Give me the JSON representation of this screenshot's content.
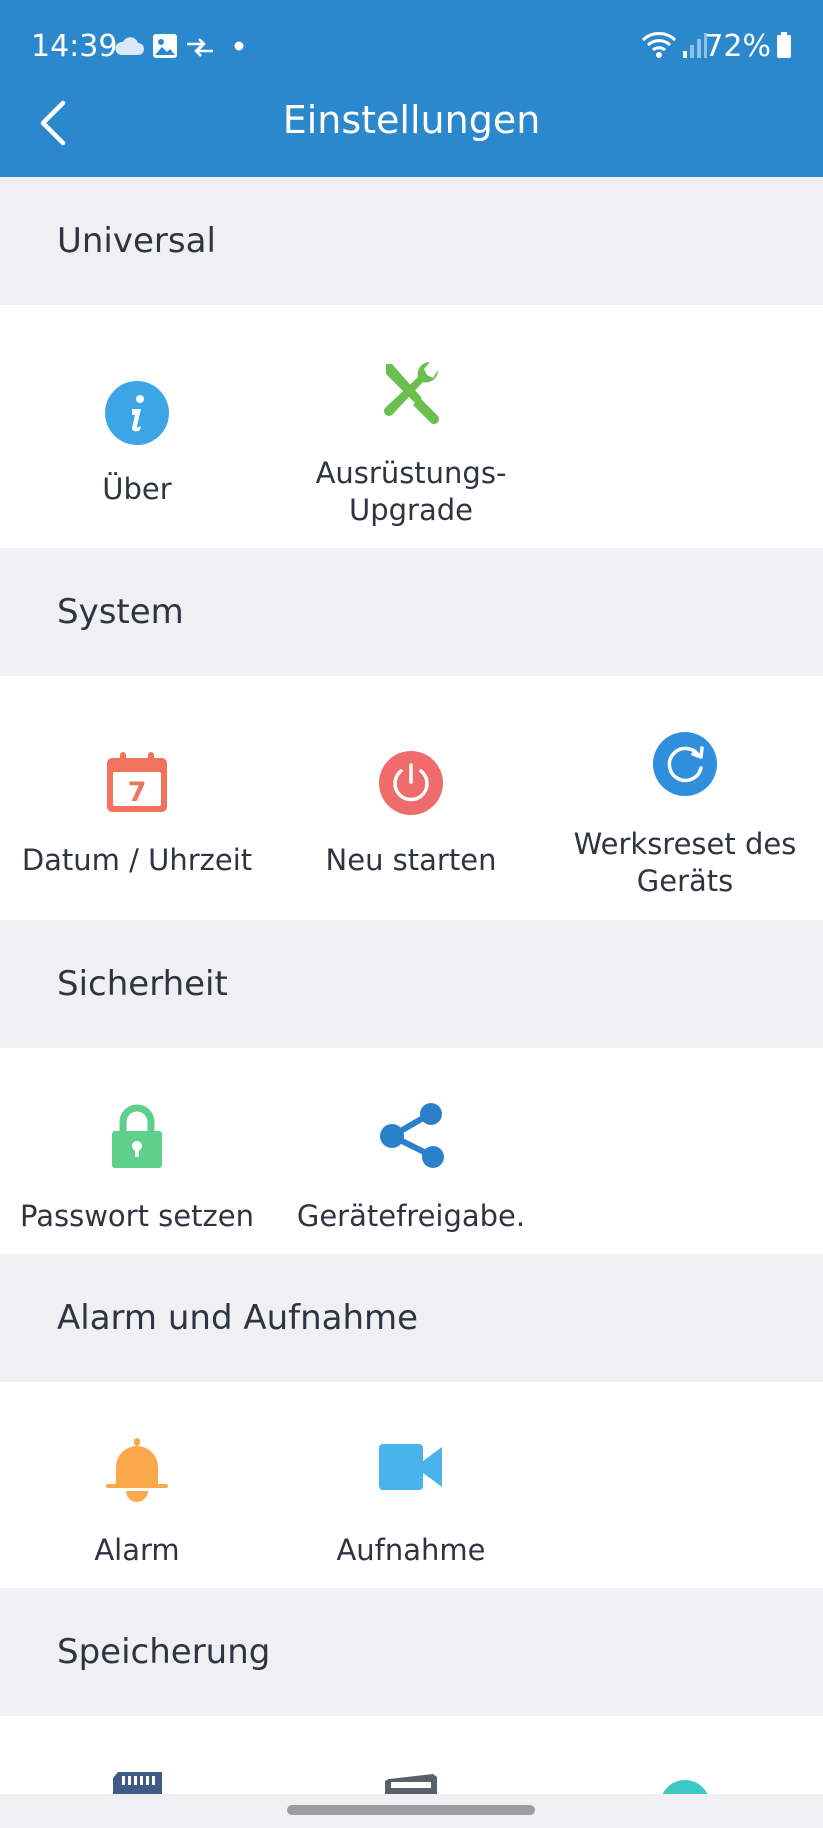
{
  "status_bar": {
    "time": "14:39",
    "battery": "72%",
    "icons": [
      "cloud-icon",
      "gallery-icon",
      "transfer-icon",
      "dot-icon",
      "wifi-icon",
      "signal-icon",
      "battery-icon"
    ]
  },
  "header": {
    "title": "Einstellungen",
    "back_icon": "chevron-left-icon"
  },
  "colors": {
    "header_bg": "#2b88cd",
    "section_bg": "#efeff4",
    "card_bg": "#ffffff",
    "info_icon": "#3ba5e6",
    "tools_icon": "#6cbf4f",
    "calendar_icon": "#f2735c",
    "power_icon": "#f06b6b",
    "reset_icon": "#2f8fdd",
    "lock_icon": "#5fcf8c",
    "share_icon": "#2b80cc",
    "alarm_icon": "#f9a94b",
    "video_icon": "#4ab3ec"
  },
  "sections": [
    {
      "title": "Universal",
      "items": [
        {
          "label": "Über",
          "icon": "info-icon"
        },
        {
          "label": "Ausrüstungs-\nUpgrade",
          "icon": "tools-icon"
        }
      ]
    },
    {
      "title": "System",
      "items": [
        {
          "label": "Datum / Uhrzeit",
          "icon": "calendar-icon",
          "calendar_day": "7"
        },
        {
          "label": "Neu starten",
          "icon": "power-icon"
        },
        {
          "label": "Werksreset des\nGeräts",
          "icon": "reset-icon"
        }
      ]
    },
    {
      "title": "Sicherheit",
      "items": [
        {
          "label": "Passwort setzen",
          "icon": "lock-icon"
        },
        {
          "label": "Gerätefreigabe.",
          "icon": "share-icon"
        }
      ]
    },
    {
      "title": "Alarm und Aufnahme",
      "items": [
        {
          "label": "Alarm",
          "icon": "bell-icon"
        },
        {
          "label": "Aufnahme",
          "icon": "video-icon"
        }
      ]
    },
    {
      "title": "Speicherung",
      "items": [
        {
          "label": "",
          "icon": "sd-card-icon"
        },
        {
          "label": "",
          "icon": "storage-icon"
        },
        {
          "label": "",
          "icon": "cloud-storage-icon"
        }
      ]
    }
  ]
}
